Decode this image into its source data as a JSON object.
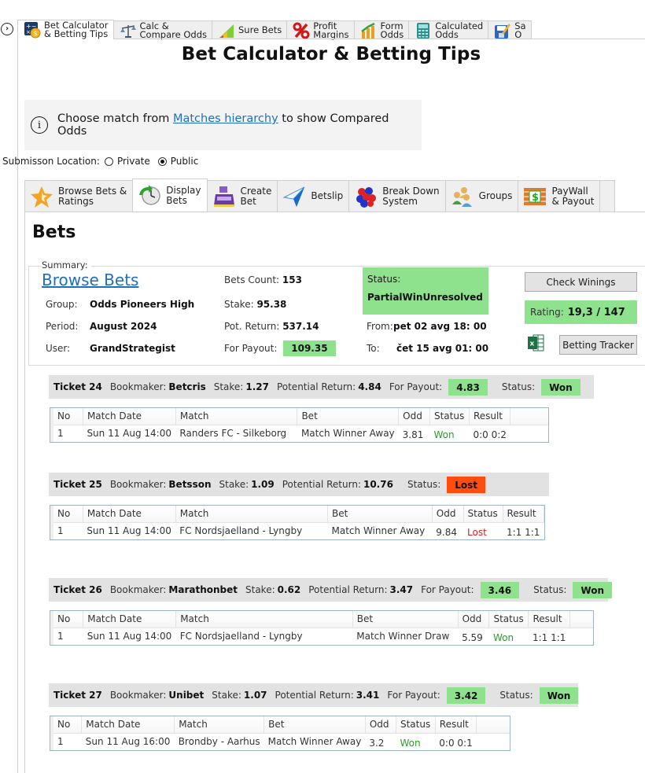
{
  "top_tabs": [
    {
      "line1": "Bet Calculator",
      "line2": "& Betting Tips",
      "icon": "calculator-coin-icon",
      "active": true
    },
    {
      "line1": "Calc &",
      "line2": "Compare Odds",
      "icon": "scales-icon",
      "active": false
    },
    {
      "line1": "Sure Bets",
      "line2": "",
      "icon": "rising-chart-icon",
      "active": false
    },
    {
      "line1": "Profit",
      "line2": "Margins",
      "icon": "percent-icon",
      "active": false
    },
    {
      "line1": "Form",
      "line2": "Odds",
      "icon": "bar-chart-arrow-icon",
      "active": false
    },
    {
      "line1": "Calculated",
      "line2": "Odds",
      "icon": "calculator-icon",
      "active": false
    },
    {
      "line1": "Sa",
      "line2": "O",
      "icon": "save-edit-icon",
      "active": false
    }
  ],
  "page_title": "Bet Calculator & Betting Tips",
  "info": {
    "text_before": "Choose match from ",
    "link": "Matches hierarchy",
    "text_after": " to show Compared Odds"
  },
  "location": {
    "label": "Submisson Location:",
    "options": [
      {
        "label": "Private",
        "selected": false
      },
      {
        "label": "Public",
        "selected": true
      }
    ]
  },
  "sub_tabs": [
    {
      "line1": "Browse Bets &",
      "line2": "Ratings",
      "icon": "star-icon",
      "active": false
    },
    {
      "line1": "Display",
      "line2": "Bets",
      "icon": "clock-refresh-icon",
      "active": true
    },
    {
      "line1": "Create",
      "line2": "Bet",
      "icon": "cash-register-icon",
      "active": false
    },
    {
      "line1": "Betslip",
      "line2": "",
      "icon": "paper-plane-icon",
      "active": false
    },
    {
      "line1": "Break Down",
      "line2": "System",
      "icon": "molecule-icon",
      "active": false
    },
    {
      "line1": "Groups",
      "line2": "",
      "icon": "users-group-icon",
      "active": false
    },
    {
      "line1": "PayWall",
      "line2": "& Payout",
      "icon": "paywall-dollar-icon",
      "active": false
    }
  ],
  "bets_heading": "Bets",
  "summary": {
    "legend": "Summary:",
    "browse_link": "Browse Bets",
    "group_label": "Group:",
    "group": "Odds Pioneers High",
    "period_label": "Period:",
    "period": "August 2024",
    "user_label": "User:",
    "user": "GrandStrategist",
    "bets_count_label": "Bets Count:",
    "bets_count": "153",
    "stake_label": "Stake:",
    "stake": "95.38",
    "pot_return_label": "Pot. Return:",
    "pot_return": "537.14",
    "for_payout_label": "For Payout:",
    "for_payout": "109.35",
    "status_label": "Status:",
    "status": "PartialWinUnresolved",
    "from_label": "From:",
    "from": "pet 02 avg 18: 00",
    "to_label": "To:",
    "to": "čet 15 avg 01: 00",
    "check_winnings": "Check Winings",
    "rating_label": "Rating:",
    "rating": "19,3 / 147",
    "betting_tracker": "Betting Tracker"
  },
  "labels": {
    "ticket": "Ticket",
    "bookmaker": "Bookmaker:",
    "stake": "Stake:",
    "potential_return": "Potential Return:",
    "for_payout": "For Payout:",
    "status": "Status:"
  },
  "columns": [
    "No",
    "Match Date",
    "Match",
    "Bet",
    "Odd",
    "Status",
    "Result"
  ],
  "tickets": [
    {
      "number": "24",
      "bookmaker": "Betcris",
      "stake": "1.27",
      "potential_return": "4.84",
      "for_payout": "4.83",
      "status": "Won",
      "rows": [
        {
          "no": "1",
          "date": "Sun 11 Aug 14:00",
          "match": "Randers FC - Silkeborg",
          "bet": "Match Winner Away",
          "odd": "3.81",
          "status": "Won",
          "result": "0:0 0:2"
        }
      ]
    },
    {
      "number": "25",
      "bookmaker": "Betsson",
      "stake": "1.09",
      "potential_return": "10.76",
      "for_payout": null,
      "status": "Lost",
      "rows": [
        {
          "no": "1",
          "date": "Sun 11 Aug 14:00",
          "match": "FC Nordsjaelland - Lyngby",
          "bet": "Match Winner Away",
          "odd": "9.84",
          "status": "Lost",
          "result": "1:1 1:1"
        }
      ]
    },
    {
      "number": "26",
      "bookmaker": "Marathonbet",
      "stake": "0.62",
      "potential_return": "3.47",
      "for_payout": "3.46",
      "status": "Won",
      "rows": [
        {
          "no": "1",
          "date": "Sun 11 Aug 14:00",
          "match": "FC Nordsjaelland - Lyngby",
          "bet": "Match Winner Draw",
          "odd": "5.59",
          "status": "Won",
          "result": "1:1 1:1"
        }
      ]
    },
    {
      "number": "27",
      "bookmaker": "Unibet",
      "stake": "1.07",
      "potential_return": "3.41",
      "for_payout": "3.42",
      "status": "Won",
      "rows": [
        {
          "no": "1",
          "date": "Sun 11 Aug 16:00",
          "match": "Brondby - Aarhus",
          "bet": "Match Winner Away",
          "odd": "3.2",
          "status": "Won",
          "result": "0:0 0:1"
        }
      ]
    }
  ],
  "colors": {
    "won_bg": "#8ee28e",
    "lost_bg": "#ff4d0f",
    "won_text": "#2e9a2e",
    "lost_text": "#e02020",
    "link": "#1f6fbf"
  }
}
